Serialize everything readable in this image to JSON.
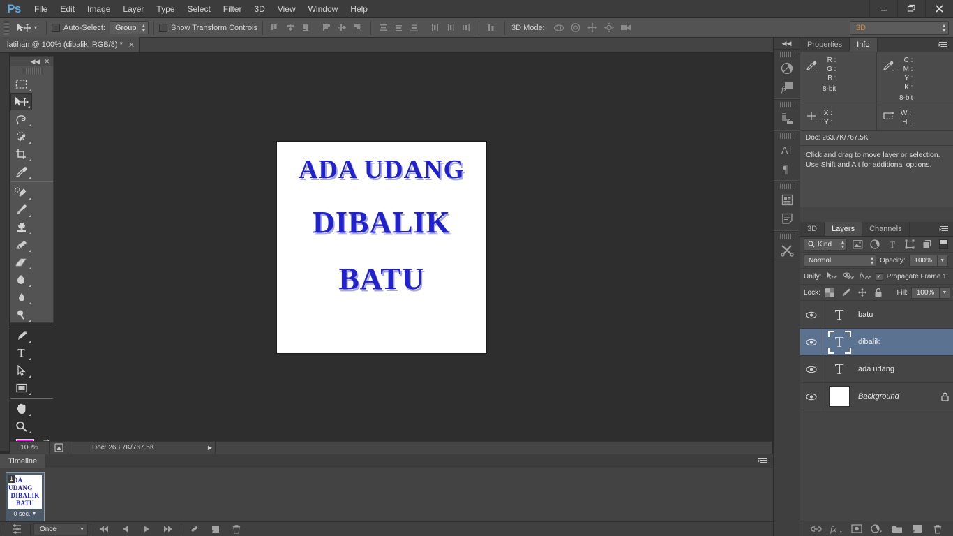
{
  "app": {
    "logo": "Ps",
    "menus": [
      "File",
      "Edit",
      "Image",
      "Layer",
      "Type",
      "Select",
      "Filter",
      "3D",
      "View",
      "Window",
      "Help"
    ],
    "window_controls": {
      "minimize": "—",
      "restore": "❐",
      "close": "✕"
    }
  },
  "options_bar": {
    "auto_select_label": "Auto-Select:",
    "auto_select_value": "Group",
    "show_transform_label": "Show Transform Controls",
    "mode_3d_label": "3D Mode:",
    "workspace": "3D"
  },
  "document_tab": {
    "title": "latihan @ 100% (dibalik, RGB/8) *",
    "close": "✕"
  },
  "toolbox": {
    "collapse": "◀◀",
    "close": "✕",
    "tools": [
      {
        "name": "rectangular-marquee-tool",
        "active": false
      },
      {
        "name": "move-tool",
        "active": true
      },
      {
        "name": "lasso-tool",
        "active": false
      },
      {
        "name": "quick-selection-tool",
        "active": false
      },
      {
        "name": "crop-tool",
        "active": false
      },
      {
        "name": "eyedropper-tool",
        "active": false
      },
      {
        "name": "spot-healing-brush-tool",
        "active": false
      },
      {
        "name": "brush-tool",
        "active": false
      },
      {
        "name": "clone-stamp-tool",
        "active": false
      },
      {
        "name": "history-brush-tool",
        "active": false
      },
      {
        "name": "eraser-tool",
        "active": false
      },
      {
        "name": "gradient-tool",
        "active": false
      },
      {
        "name": "blur-tool",
        "active": false
      },
      {
        "name": "dodge-tool",
        "active": false
      },
      {
        "name": "pen-tool",
        "active": false
      },
      {
        "name": "horizontal-type-tool",
        "active": false
      },
      {
        "name": "path-selection-tool",
        "active": false
      },
      {
        "name": "rectangle-tool",
        "active": false
      },
      {
        "name": "hand-tool",
        "active": false
      },
      {
        "name": "zoom-tool",
        "active": false
      }
    ],
    "foreground_color": "#f212f2",
    "background_color": "#ffffff",
    "bottom_tools": [
      {
        "name": "quick-mask-mode-button"
      },
      {
        "name": "screen-mode-button"
      }
    ]
  },
  "canvas": {
    "artwork_lines": [
      "ADA UDANG",
      "DIBALIK",
      "BATU"
    ],
    "text_color": "#2222cc",
    "background_color": "#ffffff"
  },
  "status_bar": {
    "zoom": "100%",
    "doc": "Doc: 263.7K/767.5K",
    "arrow": "▶"
  },
  "timeline": {
    "tab": "Timeline",
    "frames": [
      {
        "number": "1",
        "lines": [
          "ADA UDANG",
          "DIBALIK",
          "BATU"
        ],
        "delay": "0 sec."
      }
    ],
    "loop_option": "Once",
    "controls": [
      {
        "name": "tween-button"
      },
      {
        "name": "select-first-frame-button"
      },
      {
        "name": "select-previous-frame-button"
      },
      {
        "name": "play-animation-button"
      },
      {
        "name": "select-next-frame-button"
      },
      {
        "name": "tween-frames-button"
      },
      {
        "name": "duplicate-frame-button"
      },
      {
        "name": "delete-frame-button"
      }
    ]
  },
  "icon_dock": {
    "collapse": "◀◀",
    "groups": [
      [
        "adjustments-icon",
        "styles-icon"
      ],
      [
        "history-icon"
      ],
      [
        "character-icon",
        "paragraph-icon"
      ],
      [
        "layer-comps-icon",
        "notes-icon"
      ],
      [
        "tool-presets-icon"
      ]
    ]
  },
  "info_panel": {
    "tabs": [
      {
        "label": "Properties",
        "active": false
      },
      {
        "label": "Info",
        "active": true
      }
    ],
    "rgb_keys": [
      "R :",
      "G :",
      "B :"
    ],
    "rgb_bit": "8-bit",
    "cmyk_keys": [
      "C :",
      "M :",
      "Y :",
      "K :"
    ],
    "cmyk_bit": "8-bit",
    "pos_keys": [
      "X :",
      "Y :"
    ],
    "size_keys": [
      "W :",
      "H :"
    ],
    "doc_size": "Doc: 263.7K/767.5K",
    "hint_line1": "Click and drag to move layer or selection.",
    "hint_line2": "Use Shift and Alt for additional options."
  },
  "layers_panel": {
    "tabs": [
      {
        "label": "3D",
        "active": false
      },
      {
        "label": "Layers",
        "active": true
      },
      {
        "label": "Channels",
        "active": false
      }
    ],
    "kind_filter": "Kind",
    "filter_icons": [
      "pixel-layers-filter-icon",
      "adjustment-layers-filter-icon",
      "type-layers-filter-icon",
      "shape-layers-filter-icon",
      "smart-object-filter-icon"
    ],
    "blend_mode": "Normal",
    "opacity_label": "Opacity:",
    "opacity_value": "100%",
    "unify_label": "Unify:",
    "propagate_label": "Propagate Frame 1",
    "propagate_checked": true,
    "lock_label": "Lock:",
    "fill_label": "Fill:",
    "fill_value": "100%",
    "layers": [
      {
        "name": "batu",
        "type": "text",
        "visible": true,
        "selected": false,
        "locked": false
      },
      {
        "name": "dibalik",
        "type": "text",
        "visible": true,
        "selected": true,
        "locked": false
      },
      {
        "name": "ada udang",
        "type": "text",
        "visible": true,
        "selected": false,
        "locked": false
      },
      {
        "name": "Background",
        "type": "image",
        "visible": true,
        "selected": false,
        "locked": true
      }
    ],
    "footer_buttons": [
      {
        "name": "link-layers-button"
      },
      {
        "name": "layer-style-button"
      },
      {
        "name": "layer-mask-button"
      },
      {
        "name": "new-adjustment-layer-button"
      },
      {
        "name": "new-group-button"
      },
      {
        "name": "new-layer-button"
      },
      {
        "name": "delete-layer-button"
      }
    ]
  },
  "colors": {
    "accent_selected": "#5c7291",
    "panel_bg": "#454545",
    "canvas_bg": "#2e2e2e",
    "workspace_text": "#d08a3c",
    "logo_blue": "#5fa8dd"
  }
}
